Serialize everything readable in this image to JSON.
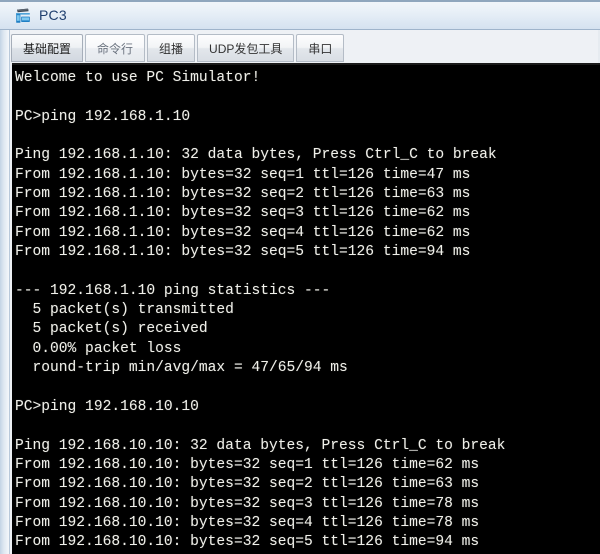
{
  "window": {
    "title": "PC3",
    "icon": "pc-device-icon"
  },
  "tabs": [
    {
      "label": "基础配置",
      "name": "tab-basic-config",
      "state": "first"
    },
    {
      "label": "命令行",
      "name": "tab-command-line",
      "state": "dim"
    },
    {
      "label": "组播",
      "name": "tab-multicast",
      "state": "normal"
    },
    {
      "label": "UDP发包工具",
      "name": "tab-udp-packet-tool",
      "state": "normal"
    },
    {
      "label": "串口",
      "name": "tab-serial-port",
      "state": "normal"
    }
  ],
  "terminal": {
    "background": "#000000",
    "foreground": "#f0f0ea",
    "lines": [
      "Welcome to use PC Simulator!",
      "",
      "PC>ping 192.168.1.10",
      "",
      "Ping 192.168.1.10: 32 data bytes, Press Ctrl_C to break",
      "From 192.168.1.10: bytes=32 seq=1 ttl=126 time=47 ms",
      "From 192.168.1.10: bytes=32 seq=2 ttl=126 time=63 ms",
      "From 192.168.1.10: bytes=32 seq=3 ttl=126 time=62 ms",
      "From 192.168.1.10: bytes=32 seq=4 ttl=126 time=62 ms",
      "From 192.168.1.10: bytes=32 seq=5 ttl=126 time=94 ms",
      "",
      "--- 192.168.1.10 ping statistics ---",
      "  5 packet(s) transmitted",
      "  5 packet(s) received",
      "  0.00% packet loss",
      "  round-trip min/avg/max = 47/65/94 ms",
      "",
      "PC>ping 192.168.10.10",
      "",
      "Ping 192.168.10.10: 32 data bytes, Press Ctrl_C to break",
      "From 192.168.10.10: bytes=32 seq=1 ttl=126 time=62 ms",
      "From 192.168.10.10: bytes=32 seq=2 ttl=126 time=63 ms",
      "From 192.168.10.10: bytes=32 seq=3 ttl=126 time=78 ms",
      "From 192.168.10.10: bytes=32 seq=4 ttl=126 time=78 ms",
      "From 192.168.10.10: bytes=32 seq=5 ttl=126 time=94 ms"
    ]
  }
}
